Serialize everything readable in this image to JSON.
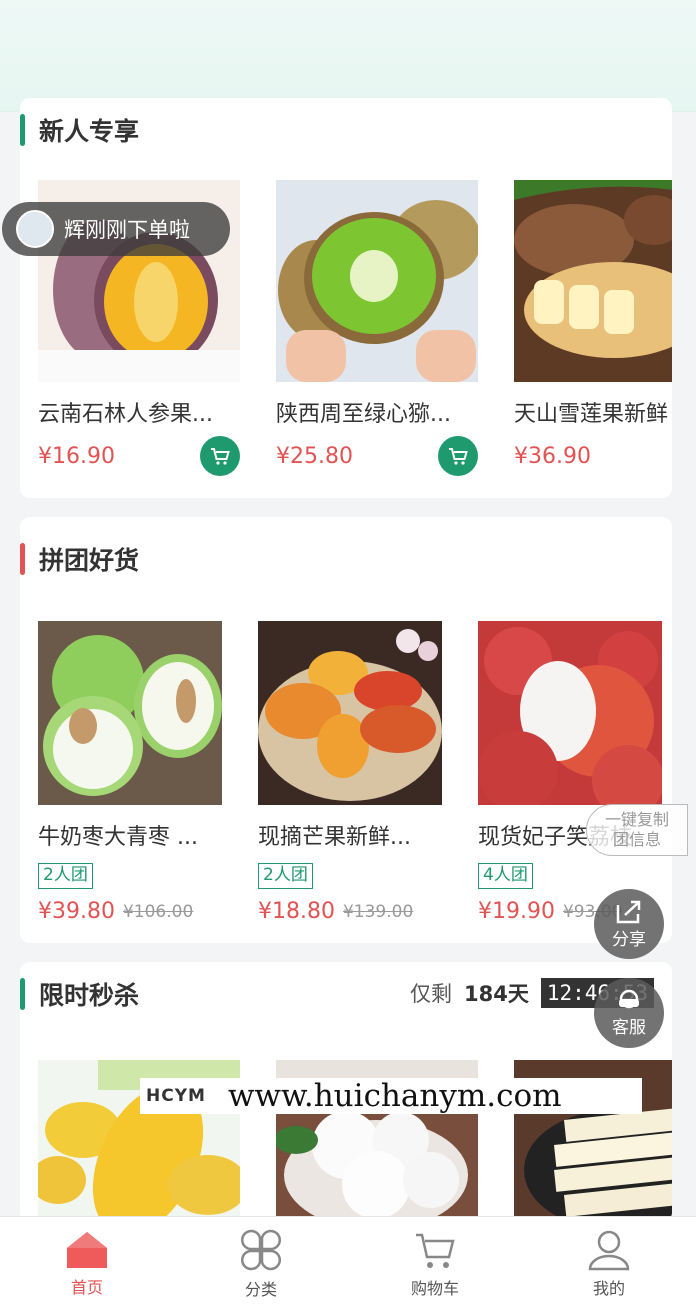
{
  "notice": {
    "text": "辉刚刚下单啦"
  },
  "newcomer": {
    "title": "新人专享",
    "items": [
      {
        "name": "云南石林人参果...",
        "price": "¥16.90"
      },
      {
        "name": "陕西周至绿心猕...",
        "price": "¥25.80"
      },
      {
        "name": "天山雪莲果新鲜",
        "price": "¥36.90"
      }
    ]
  },
  "group": {
    "title": "拼团好货",
    "items": [
      {
        "name": "牛奶枣大青枣 ...",
        "badge": "2人团",
        "price": "¥39.80",
        "old_price": "¥106.00"
      },
      {
        "name": "现摘芒果新鲜...",
        "badge": "2人团",
        "price": "¥18.80",
        "old_price": "¥139.00"
      },
      {
        "name": "现货妃子笑荔枝",
        "badge": "4人团",
        "price": "¥19.90",
        "old_price": "¥93.00"
      }
    ]
  },
  "flash": {
    "title": "限时秒杀",
    "remain_label": "仅剩",
    "days": "184天",
    "time": "12:46:53"
  },
  "floating": {
    "copy_line1": "一键复制",
    "copy_line2": "团信息",
    "share": "分享",
    "service": "客服"
  },
  "watermark": {
    "logo": "HCYM",
    "url": "www.huichanym.com"
  },
  "tabbar": [
    {
      "label": "首页",
      "icon": "home-icon",
      "active": true
    },
    {
      "label": "分类",
      "icon": "category-icon",
      "active": false
    },
    {
      "label": "购物车",
      "icon": "cart-icon",
      "active": false
    },
    {
      "label": "我的",
      "icon": "user-icon",
      "active": false
    }
  ],
  "colors": {
    "accent_green": "#1f9a6e",
    "price_red": "#e25353",
    "group_bar": "#e25353"
  }
}
